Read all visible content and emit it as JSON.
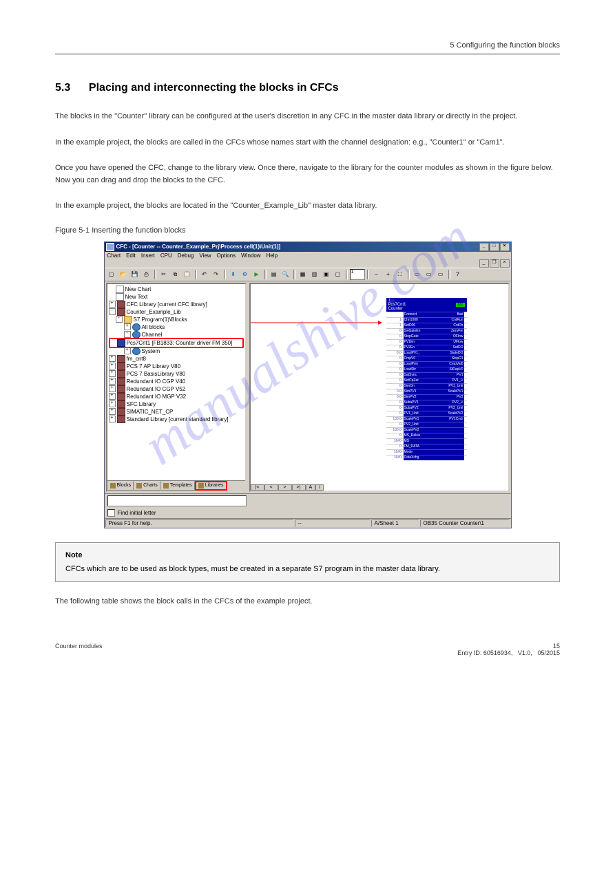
{
  "header": {
    "chapter": "5 Configuring the function blocks"
  },
  "section": {
    "number": "5.3",
    "title": "Placing and interconnecting the blocks in CFCs"
  },
  "para1": "The blocks in the \"Counter\" library can be configured at the user's discretion in any CFC in the master data library or directly in the project.",
  "para2": "In the example project, the blocks are called in the CFCs whose names start with the channel designation: e.g., \"Counter1\" or \"Cam1\".",
  "para3": "Once you have opened the CFC, change to the library view. Once there, navigate to the library for the counter modules as shown in the figure below. Now you can drag and drop the blocks to the CFC.",
  "para4": "In the example project, the blocks are located in the \"Counter_Example_Lib\" master data library.",
  "figure_caption": "Figure 5-1 Inserting the function blocks",
  "app": {
    "titlebar": {
      "icon": "cfc-app-icon",
      "text": "CFC - [Counter -- Counter_Example_Prj\\Process cell(1)\\Unit(1)]"
    },
    "menubar": [
      "Chart",
      "Edit",
      "Insert",
      "CPU",
      "Debug",
      "View",
      "Options",
      "Window",
      "Help"
    ],
    "toolbar_icons": [
      "new",
      "open",
      "save",
      "print",
      "sep",
      "cut",
      "copy",
      "paste",
      "sep",
      "undo",
      "redo",
      "sep",
      "download",
      "compile",
      "sep",
      "run",
      "stop",
      "sep",
      "catalog",
      "find",
      "sep",
      "grid1",
      "grid2",
      "grid3",
      "grid4",
      "sep",
      "page",
      "sep",
      "zoomout",
      "zoomin",
      "zoomfit",
      "sep",
      "t1",
      "t2",
      "t3",
      "sep",
      "help"
    ],
    "toolbar_combo": "1",
    "tree": [
      {
        "ind": 0,
        "exp": "",
        "icon": "file",
        "label": "New Chart"
      },
      {
        "ind": 0,
        "exp": "",
        "icon": "file",
        "label": "New Text"
      },
      {
        "ind": 0,
        "exp": "+",
        "icon": "book",
        "label": "CFC Library  [current CFC library]"
      },
      {
        "ind": 0,
        "exp": "-",
        "icon": "book",
        "label": "Counter_Example_Lib"
      },
      {
        "ind": 1,
        "exp": "-",
        "icon": "folder",
        "label": "S7 Program(1)\\Blocks"
      },
      {
        "ind": 2,
        "exp": "+",
        "icon": "globe",
        "label": "All blocks"
      },
      {
        "ind": 2,
        "exp": "-",
        "icon": "globe",
        "label": "Channel"
      },
      {
        "ind": 3,
        "exp": "",
        "icon": "block",
        "label": "Pcs7Cnt1 [FB1833: Counter driver FM 350]",
        "hl": true
      },
      {
        "ind": 2,
        "exp": "+",
        "icon": "globe",
        "label": "System"
      },
      {
        "ind": 0,
        "exp": "+",
        "icon": "book",
        "label": "fm_cnt8"
      },
      {
        "ind": 0,
        "exp": "+",
        "icon": "book",
        "label": "PCS 7 AP Library V80"
      },
      {
        "ind": 0,
        "exp": "+",
        "icon": "book",
        "label": "PCS 7 BasisLibrary V80"
      },
      {
        "ind": 0,
        "exp": "+",
        "icon": "book",
        "label": "Redundant IO CGP V40"
      },
      {
        "ind": 0,
        "exp": "+",
        "icon": "book",
        "label": "Redundant IO CGP V52"
      },
      {
        "ind": 0,
        "exp": "+",
        "icon": "book",
        "label": "Redundant IO MGP V32"
      },
      {
        "ind": 0,
        "exp": "+",
        "icon": "book",
        "label": "SFC Library"
      },
      {
        "ind": 0,
        "exp": "+",
        "icon": "book",
        "label": "SIMATIC_NET_CP"
      },
      {
        "ind": 0,
        "exp": "+",
        "icon": "book",
        "label": "Standard Library  [current standard library]"
      }
    ],
    "bottom_tabs": [
      {
        "label": "Blocks",
        "active": false
      },
      {
        "label": "Charts",
        "active": false
      },
      {
        "label": "Templates",
        "active": false
      },
      {
        "label": "Libraries",
        "active": true
      }
    ],
    "block": {
      "name": "Pcs7Cnt1",
      "type": "Counter",
      "instance": "1/1",
      "rows": [
        {
          "lv": "",
          "ln": "Connect",
          "rn": "Bad"
        },
        {
          "lv": "1-",
          "ln": "Chn1000",
          "rn": "CntRun"
        },
        {
          "lv": "1-",
          "ln": "SetD00",
          "rn": "CntDir"
        },
        {
          "lv": "0-",
          "ln": "SwGateEn",
          "rn": "ZeroFm"
        },
        {
          "lv": "0-",
          "ln": "StopGate",
          "rn": "OFlow"
        },
        {
          "lv": "0-",
          "ln": "PV1En",
          "rn": "UFlow"
        },
        {
          "lv": "0-",
          "ln": "PV2En",
          "rn": "SetDO"
        },
        {
          "lv": "0.0-",
          "ln": "LoadPV1_",
          "rn": "StateDO"
        },
        {
          "lv": "0-",
          "ln": "CmpV0",
          "rn": "StopD1"
        },
        {
          "lv": "0-",
          "ln": "LoadPrm",
          "rn": "CmpVal0"
        },
        {
          "lv": "0-",
          "ln": "LoadDir",
          "rn": "StDapV0"
        },
        {
          "lv": "0-",
          "ln": "SatSync",
          "rn": "PV1"
        },
        {
          "lv": "0-",
          "ln": "SetCpZer",
          "rn": "PV1_Li"
        },
        {
          "lv": "0-",
          "ln": "SimOn",
          "rn": "PV1_Unit"
        },
        {
          "lv": "0.0-",
          "ln": "SimPV1",
          "rn": "ScalePV1"
        },
        {
          "lv": "0.0-",
          "ln": "SimPV2",
          "rn": "PV2"
        },
        {
          "lv": "0-",
          "ln": "SubaPV1",
          "rn": "PV2_Li"
        },
        {
          "lv": "0-",
          "ln": "SubaPV2",
          "rn": "PV2_Unit"
        },
        {
          "lv": "0-",
          "ln": "PV1_Unit",
          "rn": "ScalePV2"
        },
        {
          "lv": "100.0-",
          "ln": "ScalePV1",
          "rn": "PV1Cycli"
        },
        {
          "lv": "0-",
          "ln": "PV2_Unit",
          "rn": ""
        },
        {
          "lv": "100.0-",
          "ln": "ScalePV2",
          "rn": ""
        },
        {
          "lv": "0-",
          "ln": "MS_Relea",
          "rn": ""
        },
        {
          "lv": "16#0-",
          "ln": "MS",
          "rn": ""
        },
        {
          "lv": "0-",
          "ln": "FM_DATA",
          "rn": ""
        },
        {
          "lv": "16#0-",
          "ln": "Mode",
          "rn": ""
        },
        {
          "lv": "16#0-",
          "ln": "DataXchg",
          "rn": ""
        }
      ]
    },
    "chart_tabs": {
      "nav": [
        "|<",
        "<",
        ">",
        ">|"
      ],
      "tab": "A",
      "ruler": "/"
    },
    "find_initial_label": "Find initial letter",
    "status": {
      "help": "Press F1 for help.",
      "pos": "--",
      "sheet": "A/Sheet 1",
      "ob": "OB35  Counter  Counter\\1"
    }
  },
  "note": {
    "title": "Note",
    "body": "CFCs which are to be used as block types, must be created in a separate S7 program in the master data library."
  },
  "table_intro": "The following table shows the block calls in the CFCs of the example project.",
  "footer": {
    "left": "Counter modules",
    "right_top": "15",
    "right_bottom1": "Entry ID: 60516934",
    "right_bottom2": "V1.0,",
    "right_bottom3": "05/2015"
  },
  "watermark": "manualshive.com"
}
